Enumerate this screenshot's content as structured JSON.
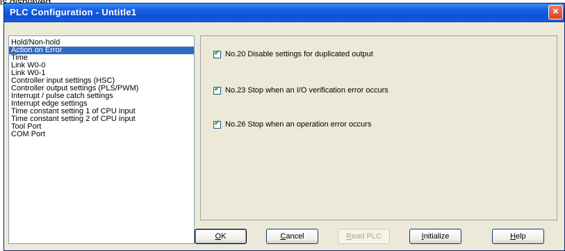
{
  "above_text": "is displayed.",
  "window": {
    "title": "PLC Configuration - Untitle1",
    "close_label": "×"
  },
  "list": {
    "items": [
      {
        "label": "Hold/Non-hold",
        "selected": false
      },
      {
        "label": "Action on Error",
        "selected": true
      },
      {
        "label": "Time",
        "selected": false
      },
      {
        "label": "Link W0-0",
        "selected": false
      },
      {
        "label": "Link W0-1",
        "selected": false
      },
      {
        "label": "Controller input settings (HSC)",
        "selected": false
      },
      {
        "label": "Controller output settings (PLS/PWM)",
        "selected": false
      },
      {
        "label": "Interrupt / pulse catch settings",
        "selected": false
      },
      {
        "label": "Interrupt edge settings",
        "selected": false
      },
      {
        "label": "Time constant setting 1 of CPU input",
        "selected": false
      },
      {
        "label": "Time constant setting 2 of CPU input",
        "selected": false
      },
      {
        "label": "Tool Port",
        "selected": false
      },
      {
        "label": "COM Port",
        "selected": false
      }
    ]
  },
  "options": [
    {
      "label": "No.20 Disable settings for duplicated output",
      "checked": true
    },
    {
      "label": "No.23 Stop when an I/O verification error occurs",
      "checked": true
    },
    {
      "label": "No.26 Stop when an operation error occurs",
      "checked": true
    }
  ],
  "buttons": {
    "ok": {
      "mnemonic": "O",
      "rest": "K"
    },
    "cancel": {
      "mnemonic": "C",
      "rest": "ancel"
    },
    "read_plc": {
      "mnemonic": "R",
      "rest": "ead PLC"
    },
    "initialize": {
      "mnemonic": "I",
      "rest": "nitialize"
    },
    "help": {
      "mnemonic": "H",
      "rest": "elp"
    }
  },
  "check_mark": "✔"
}
